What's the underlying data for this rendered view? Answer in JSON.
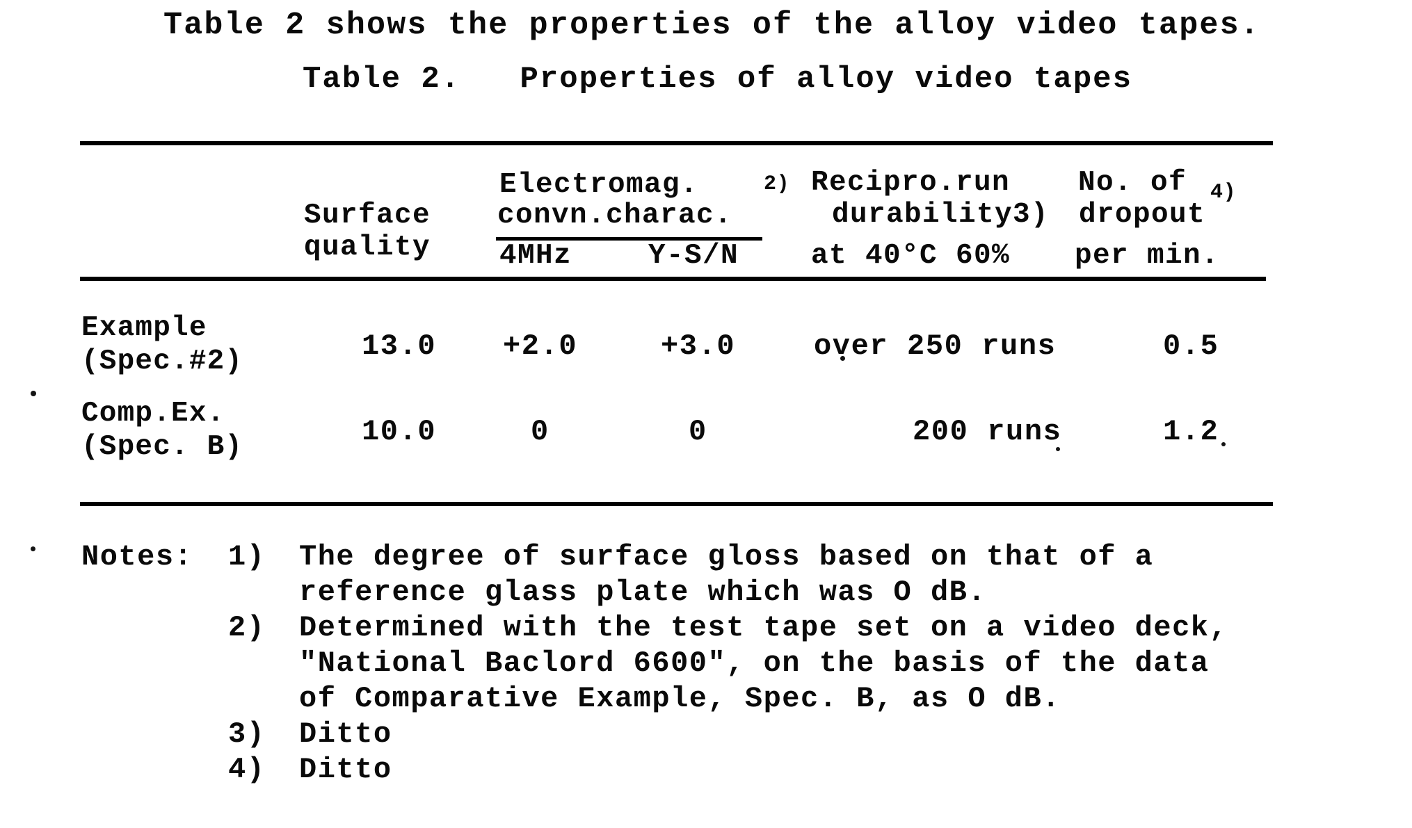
{
  "document": {
    "intro_sentence": "Table 2 shows the properties of the alloy video tapes.",
    "table_title": "Table 2.   Properties of alloy video tapes"
  },
  "table": {
    "header": {
      "stub_label": "",
      "col1_line1": "Surface",
      "col1_line2": "quality",
      "col2_group_line1": "Electromag.",
      "col2_group_line2": "convn.charac.",
      "col2_group_sup": "2)",
      "col2_sub_a": "4MHz",
      "col2_sub_b": "Y-S/N",
      "col3_line1": "Recipro.run",
      "col3_line2": "durability3)",
      "col3_line3": "at 40°C 60%",
      "col4_line1": "No. of",
      "col4_line2": "dropout",
      "col4_sup": "4)",
      "col4_line3": "per min."
    },
    "columns": [
      "Surface quality",
      "Electromag. convn.charac. 4MHz",
      "Electromag. convn.charac. Y-S/N",
      "Recipro.run durability at 40°C 60%",
      "No. of dropout per min."
    ],
    "rows": [
      {
        "label_line1": "Example",
        "label_line2": "(Spec.#2)",
        "surface_quality": "13.0",
        "emag_4mhz": "+2.0",
        "emag_ysn": "+3.0",
        "durability": "over 250 runs",
        "dropout": "0.5"
      },
      {
        "label_line1": "Comp.Ex.",
        "label_line2": "(Spec. B)",
        "surface_quality": "10.0",
        "emag_4mhz": "0",
        "emag_ysn": "0",
        "durability": "200 runs",
        "dropout": "1.2"
      }
    ]
  },
  "notes": {
    "heading": "Notes:",
    "items": [
      {
        "marker": "1)",
        "lines": [
          "The degree of surface gloss based on that of a",
          "reference glass plate which was O dB."
        ]
      },
      {
        "marker": "2)",
        "lines": [
          "Determined with the test tape set on a video deck,",
          "\"National Baclord 6600\", on the basis of the data",
          "of Comparative Example, Spec. B, as O dB."
        ]
      },
      {
        "marker": "3)",
        "lines": [
          "Ditto"
        ]
      },
      {
        "marker": "4)",
        "lines": [
          "Ditto"
        ]
      }
    ]
  },
  "colors": {
    "ink": "#0a0a0a",
    "paper": "#ffffff"
  }
}
